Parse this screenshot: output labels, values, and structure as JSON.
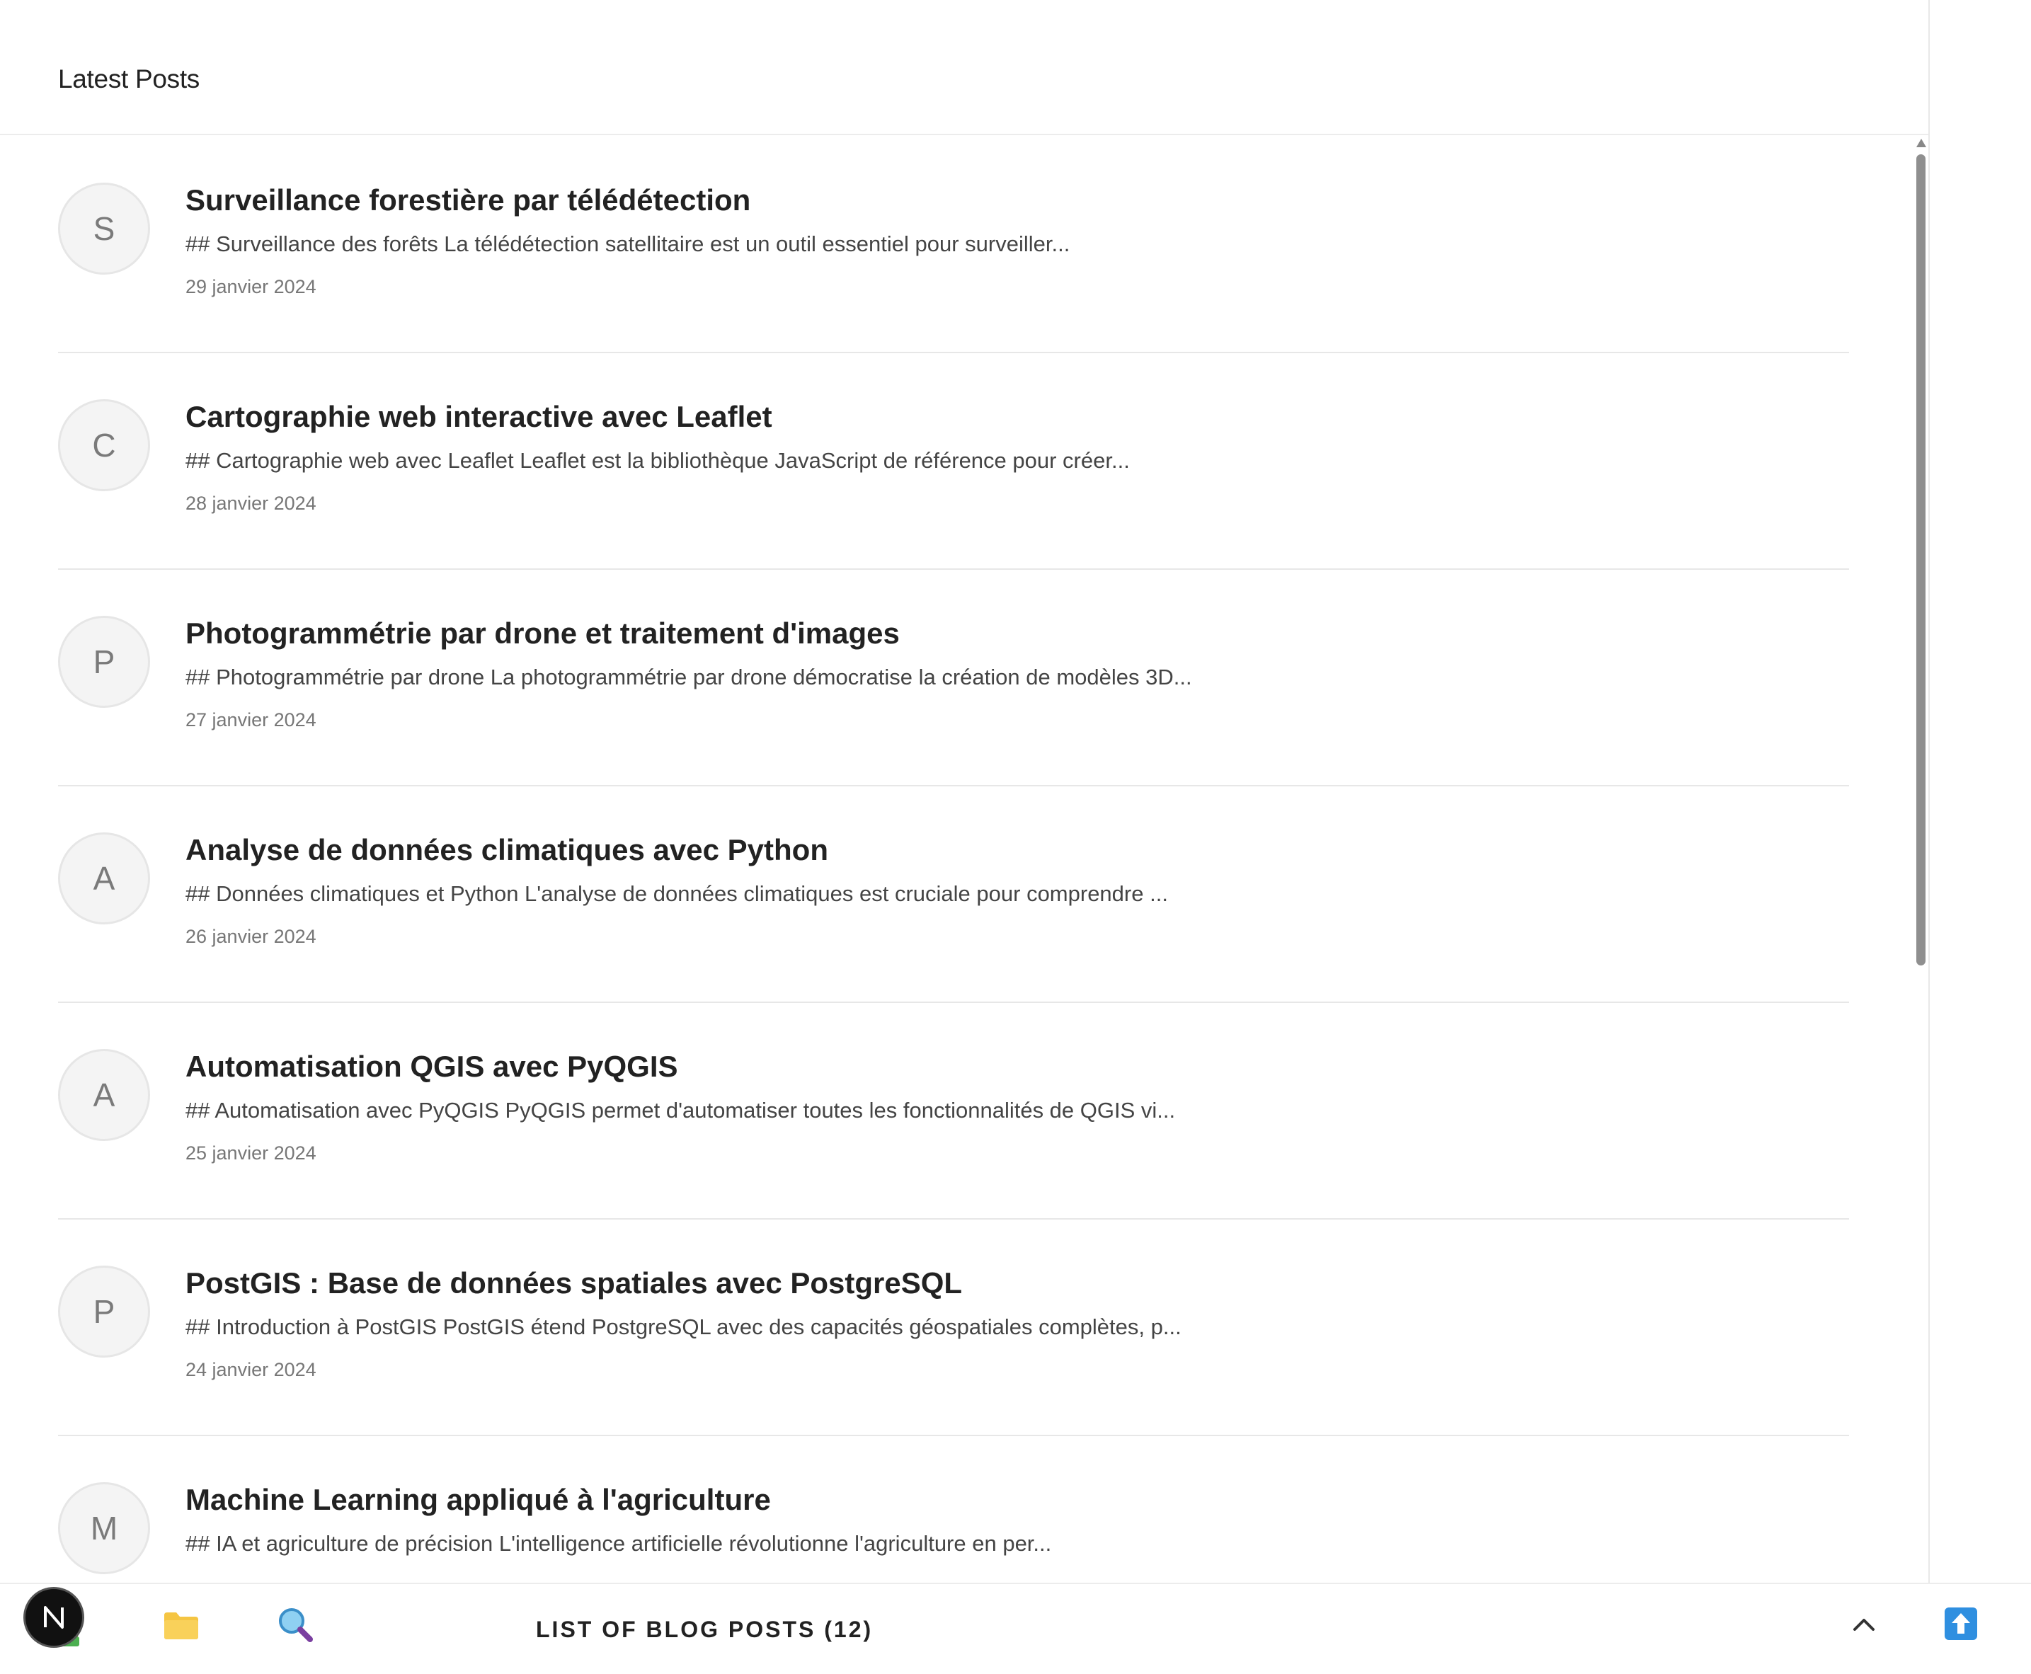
{
  "header": {
    "title": "Latest Posts"
  },
  "posts": [
    {
      "initial": "S",
      "title": "Surveillance forestière par télédétection",
      "excerpt": "## Surveillance des forêts La télédétection satellitaire est un outil essentiel pour surveiller...",
      "date": "29 janvier 2024"
    },
    {
      "initial": "C",
      "title": "Cartographie web interactive avec Leaflet",
      "excerpt": "## Cartographie web avec Leaflet Leaflet est la bibliothèque JavaScript de référence pour créer...",
      "date": "28 janvier 2024"
    },
    {
      "initial": "P",
      "title": "Photogrammétrie par drone et traitement d'images",
      "excerpt": "## Photogrammétrie par drone La photogrammétrie par drone démocratise la création de modèles 3D...",
      "date": "27 janvier 2024"
    },
    {
      "initial": "A",
      "title": "Analyse de données climatiques avec Python",
      "excerpt": "## Données climatiques et Python L'analyse de données climatiques est cruciale pour comprendre ...",
      "date": "26 janvier 2024"
    },
    {
      "initial": "A",
      "title": "Automatisation QGIS avec PyQGIS",
      "excerpt": "## Automatisation avec PyQGIS PyQGIS permet d'automatiser toutes les fonctionnalités de QGIS vi...",
      "date": "25 janvier 2024"
    },
    {
      "initial": "P",
      "title": "PostGIS : Base de données spatiales avec PostgreSQL",
      "excerpt": "## Introduction à PostGIS PostGIS étend PostgreSQL avec des capacités géospatiales complètes, p...",
      "date": "24 janvier 2024"
    },
    {
      "initial": "M",
      "title": "Machine Learning appliqué à l'agriculture",
      "excerpt": "## IA et agriculture de précision L'intelligence artificielle révolutionne l'agriculture en per...",
      "date": ""
    }
  ],
  "taskbar": {
    "title": "LIST OF BLOG POSTS (12)",
    "icons": [
      "next-logo-icon",
      "folder-icon",
      "magnifier-icon",
      "chevron-up-icon",
      "upload-arrow-icon"
    ],
    "next_badge_letter": "N"
  },
  "colors": {
    "folder": "#f5c542",
    "magnifier_lens": "#4aa3df",
    "upload_tile": "#2f8fe0"
  }
}
